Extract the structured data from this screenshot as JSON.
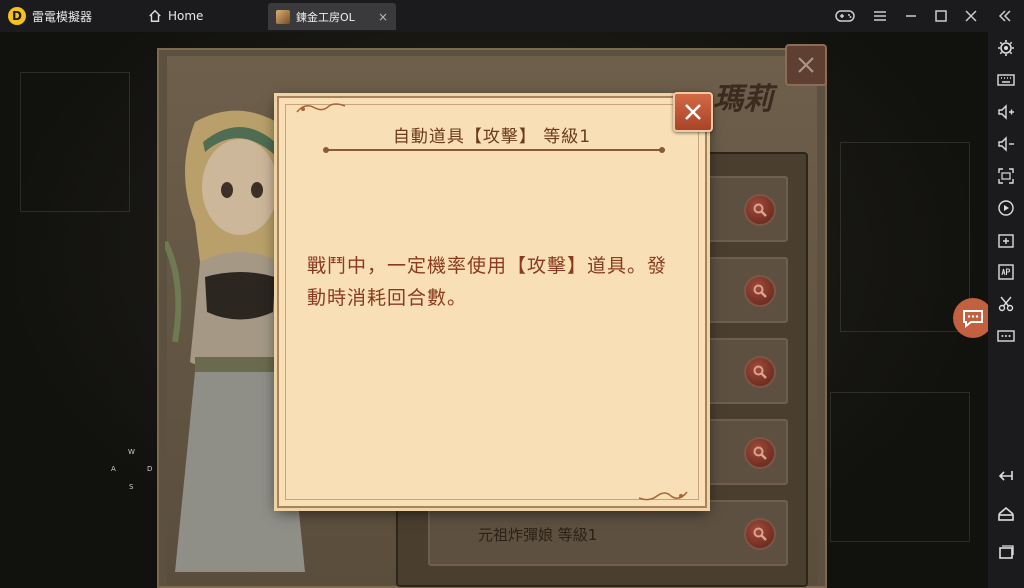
{
  "titlebar": {
    "app_name": "雷電模擬器",
    "home_tab": "Home",
    "active_tab": "鍊金工房OL",
    "tab_close": "×"
  },
  "game": {
    "character_name": "瑪莉",
    "keys": {
      "up": "W",
      "left": "A",
      "right": "D",
      "down": "S"
    },
    "list_rows": [
      {
        "label": ""
      },
      {
        "label": ""
      },
      {
        "label": ""
      },
      {
        "label": ""
      },
      {
        "label": "元祖炸彈娘  等級1"
      }
    ]
  },
  "modal": {
    "title": "自動道具【攻擊】  等級1",
    "body": "戰鬥中，一定機率使用【攻擊】道具。發動時消耗回合數。"
  },
  "colors": {
    "modal_bg": "#f8dfb5",
    "modal_text": "#8a3b1f",
    "close_btn": "#c85a37",
    "titlebar_bg": "#1b1b1d"
  },
  "icons": {
    "home": "home-icon",
    "gamepad": "gamepad-icon",
    "menu": "menu-icon",
    "minimize": "minimize-icon",
    "maximize": "maximize-icon",
    "close": "close-icon",
    "collapse": "double-chevron-left-icon"
  }
}
